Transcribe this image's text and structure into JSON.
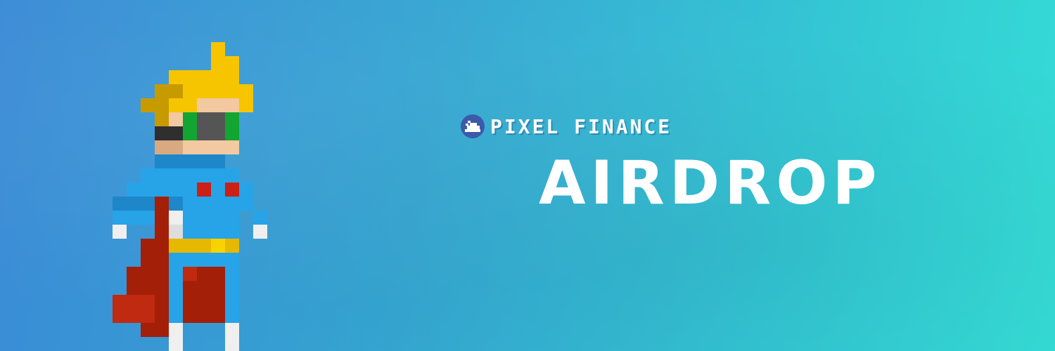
{
  "brand": {
    "name": "PIXEL FINANCE",
    "logo_icon": "cloud-pixel-logo-icon"
  },
  "headline": "AIRDROP",
  "illustration": {
    "icon": "pixel-hero-character-icon",
    "colors": {
      "hair": "#f7c400",
      "hair_shadow": "#c79a00",
      "skin": "#f2c9a0",
      "skin_shadow": "#d9a982",
      "visor": "#2f2f2f",
      "lens": "#12a531",
      "suit": "#27a3e8",
      "suit_shadow": "#1d87c9",
      "emblem": "#cc1f16",
      "cape": "#a31f08",
      "belt": "#e6b800",
      "white": "#efefef"
    }
  },
  "colors": {
    "background_left": "#3a8ad6",
    "background_right": "#35dcd6",
    "text": "#ffffff"
  }
}
